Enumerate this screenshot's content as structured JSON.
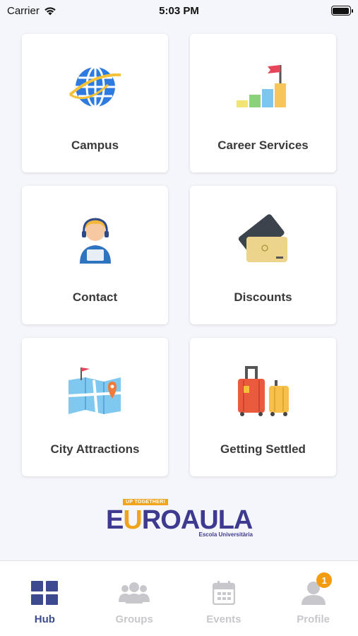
{
  "status_bar": {
    "carrier": "Carrier",
    "time": "5:03 PM"
  },
  "tiles": [
    {
      "label": "Campus",
      "icon": "globe-icon"
    },
    {
      "label": "Career Services",
      "icon": "career-growth-icon"
    },
    {
      "label": "Contact",
      "icon": "support-agent-icon"
    },
    {
      "label": "Discounts",
      "icon": "discount-cards-icon"
    },
    {
      "label": "City Attractions",
      "icon": "city-map-icon"
    },
    {
      "label": "Getting Settled",
      "icon": "luggage-icon"
    }
  ],
  "logo": {
    "tagline": "UP TOGETHER!",
    "word_prefix": "E",
    "word_u": "U",
    "word_suffix": "ROAULA",
    "subtitle": "Escola Universitària"
  },
  "tab_bar": {
    "tabs": [
      {
        "label": "Hub",
        "icon": "grid-icon",
        "active": true
      },
      {
        "label": "Groups",
        "icon": "group-icon",
        "active": false
      },
      {
        "label": "Events",
        "icon": "calendar-icon",
        "active": false
      },
      {
        "label": "Profile",
        "icon": "person-icon",
        "active": false,
        "badge": "1"
      }
    ]
  },
  "colors": {
    "accent": "#3d4a8f",
    "inactive": "#c8c8cc",
    "badge": "#f39c12",
    "logo_purple": "#3d3a8f",
    "logo_orange": "#f0a41c"
  }
}
